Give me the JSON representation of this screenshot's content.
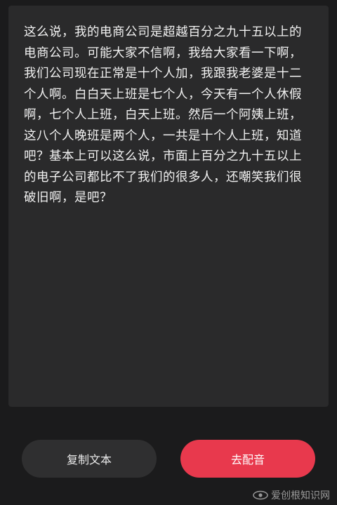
{
  "transcript": {
    "text": "这么说，我的电商公司是超越百分之九十五以上的电商公司。可能大家不信啊，我给大家看一下啊，我们公司现在正常是十个人加，我跟我老婆是十二个人啊。白白天上班是七个人，今天有一个人休假啊，七个人上班，白天上班。然后一个阿姨上班，这八个人晚班是两个人，一共是十个人上班，知道吧？基本上可以这么说，市面上百分之九十五以上的电子公司都比不了我们的很多人，还嘲笑我们很破旧啊，是吧？"
  },
  "actions": {
    "copy_label": "复制文本",
    "dub_label": "去配音"
  },
  "watermark": {
    "text": "爱创根知识网",
    "icon": "eye-logo-icon"
  },
  "colors": {
    "background": "#1b1b1c",
    "panel": "#2a2a2b",
    "copy_button": "#2f2f30",
    "dub_button": "#e8394d"
  }
}
